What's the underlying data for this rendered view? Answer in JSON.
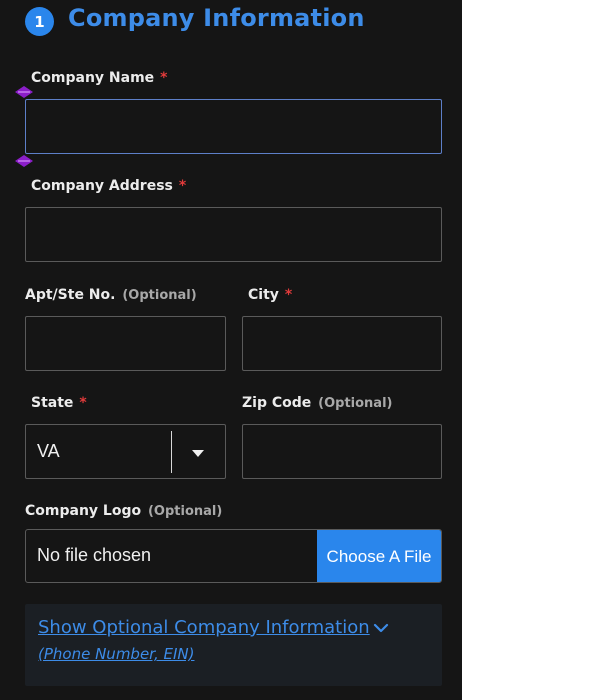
{
  "section": {
    "step_number": "1",
    "title": "Company Information"
  },
  "fields": {
    "company_name": {
      "label": "Company Name",
      "required_mark": "*",
      "value": ""
    },
    "company_address": {
      "label": "Company Address",
      "required_mark": "*",
      "value": ""
    },
    "apt": {
      "label": "Apt/Ste No.",
      "optional_note": "(Optional)",
      "value": ""
    },
    "city": {
      "label": "City",
      "required_mark": "*",
      "value": ""
    },
    "state": {
      "label": "State",
      "required_mark": "*",
      "selected": "VA"
    },
    "zip": {
      "label": "Zip Code",
      "optional_note": "(Optional)",
      "value": ""
    },
    "logo": {
      "label": "Company Logo",
      "optional_note": "(Optional)",
      "file_text": "No file chosen",
      "button_label": "Choose A File"
    }
  },
  "optional_info": {
    "link_label": "Show Optional Company Information",
    "sub_label": "(Phone Number, EIN)"
  },
  "icons": {
    "step_badge": "number-badge",
    "select_arrow": "caret-down-icon",
    "expand": "chevron-down-icon",
    "resize_handles": "diamond-handle-icon"
  },
  "colors": {
    "panel_bg": "#151515",
    "accent": "#2a86ec",
    "link": "#3d8ce8",
    "required": "#e23b3b",
    "handle": "#8b1ec9"
  }
}
